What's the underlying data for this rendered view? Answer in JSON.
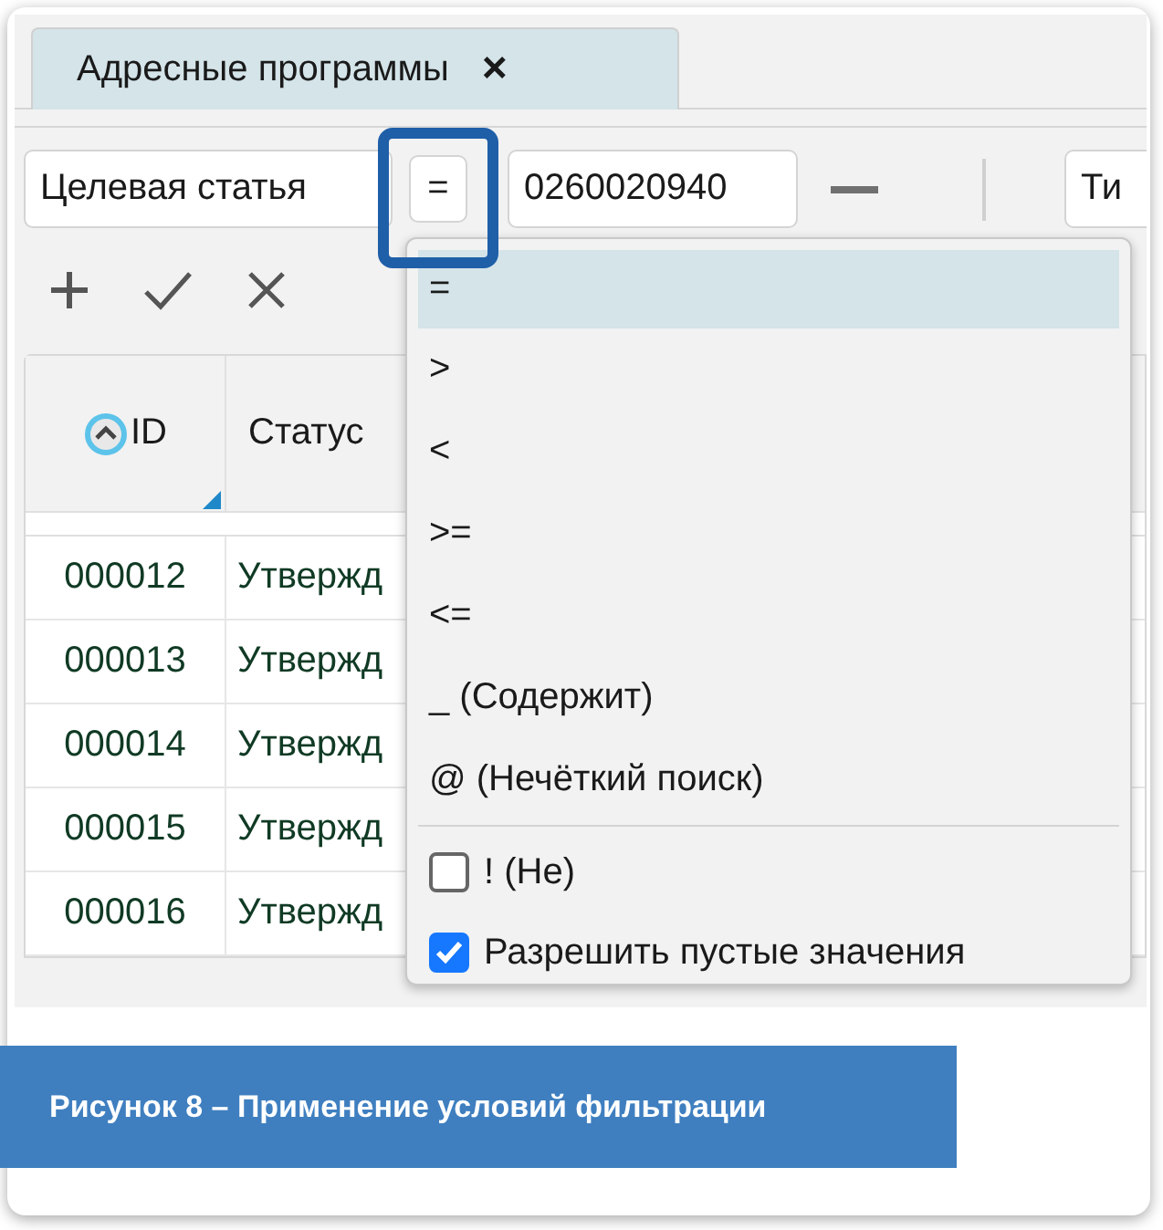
{
  "tab": {
    "label": "Адресные программы",
    "close": "×",
    "selected": true
  },
  "filter": {
    "field": "Целевая статья",
    "operator": "=",
    "value": "0260020940",
    "next_field": "Ти"
  },
  "table": {
    "columns": [
      {
        "label": "ID",
        "sorted": true
      },
      {
        "label": "Статус"
      }
    ],
    "rows": [
      {
        "id": "000012",
        "status": "Утвержд"
      },
      {
        "id": "000013",
        "status": "Утвержд"
      },
      {
        "id": "000014",
        "status": "Утвержд"
      },
      {
        "id": "000015",
        "status": "Утвержд"
      },
      {
        "id": "000016",
        "status": "Утвержд"
      }
    ]
  },
  "dropdown": {
    "options": [
      {
        "label": "=",
        "selected": true
      },
      {
        "label": ">",
        "selected": false
      },
      {
        "label": "<",
        "selected": false
      },
      {
        "label": ">=",
        "selected": false
      },
      {
        "label": "<=",
        "selected": false
      },
      {
        "label": "_ (Содержит)",
        "selected": false
      },
      {
        "label": "@ (Нечёткий поиск)",
        "selected": false
      }
    ],
    "toggles": [
      {
        "label": "! (Не)",
        "checked": false
      },
      {
        "label": "Разрешить пустые значения",
        "checked": true
      }
    ]
  },
  "caption": "Рисунок 8 – Применение условий фильтрации"
}
